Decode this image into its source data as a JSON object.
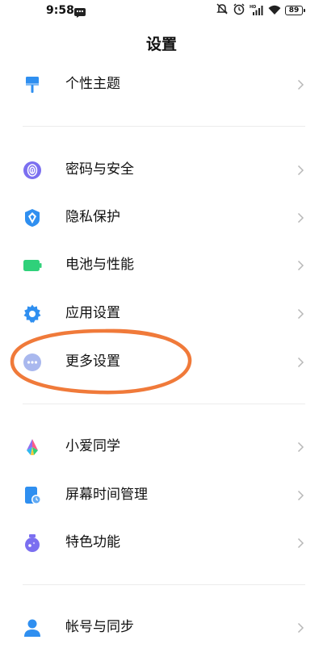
{
  "status_bar": {
    "time": "9:58",
    "battery": "89",
    "network_label": "HD"
  },
  "page": {
    "title": "设置"
  },
  "groups": [
    {
      "items": [
        {
          "label": "个性主题",
          "icon": "theme-brush-icon",
          "color": "#2f8ff0"
        }
      ]
    },
    {
      "items": [
        {
          "label": "密码与安全",
          "icon": "fingerprint-icon",
          "color": "#7b6ff0"
        },
        {
          "label": "隐私保护",
          "icon": "privacy-shield-icon",
          "color": "#2f8ff0"
        },
        {
          "label": "电池与性能",
          "icon": "battery-icon",
          "color": "#2fd17a"
        },
        {
          "label": "应用设置",
          "icon": "app-gear-icon",
          "color": "#2f8ff0"
        },
        {
          "label": "更多设置",
          "icon": "more-dots-icon",
          "color": "#8fa4e8"
        }
      ]
    },
    {
      "items": [
        {
          "label": "小爱同学",
          "icon": "xiaoai-icon",
          "color": "#ff5b8a"
        },
        {
          "label": "屏幕时间管理",
          "icon": "screen-time-icon",
          "color": "#2f8ff0"
        },
        {
          "label": "特色功能",
          "icon": "feature-flask-icon",
          "color": "#7b6ff0"
        }
      ]
    },
    {
      "items": [
        {
          "label": "帐号与同步",
          "icon": "account-icon",
          "color": "#2f8ff0"
        }
      ]
    }
  ],
  "annotation": {
    "color": "#f07a3a",
    "target": "更多设置"
  }
}
